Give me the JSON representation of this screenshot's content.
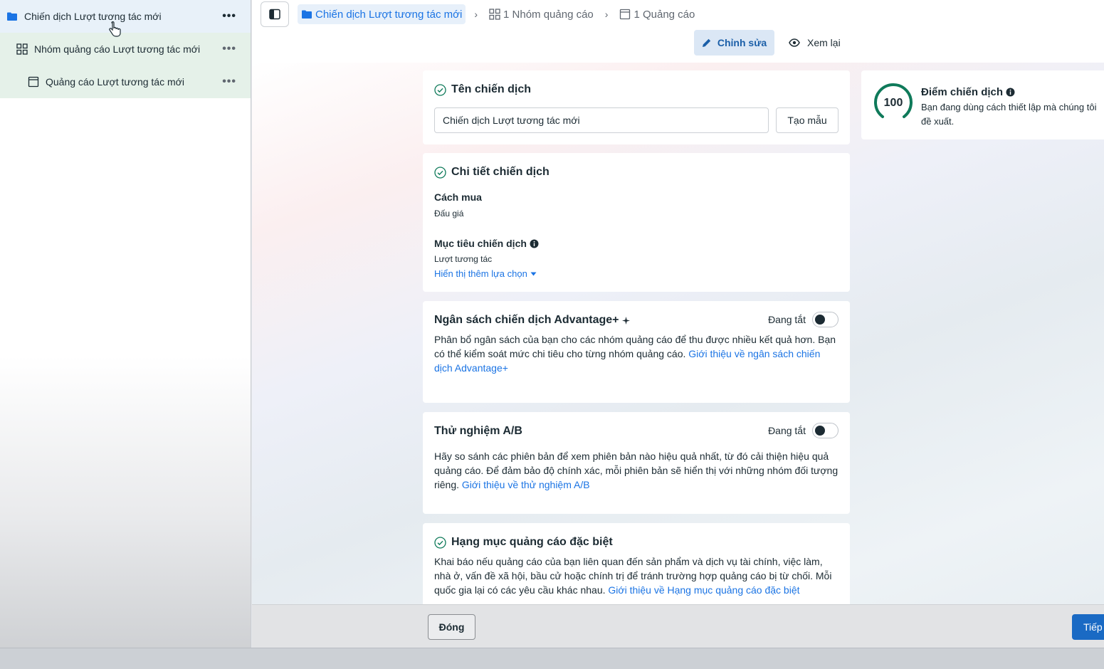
{
  "sidebar": {
    "campaign": "Chiến dịch Lượt tương tác mới",
    "adset": "Nhóm quảng cáo Lượt tương tác mới",
    "ad": "Quảng cáo Lượt tương tác mới",
    "more": "•••"
  },
  "breadcrumb": {
    "campaign": "Chiến dịch Lượt tương tác mới",
    "adsets": "1 Nhóm quảng cáo",
    "ads": "1 Quảng cáo"
  },
  "modes": {
    "edit": "Chỉnh sửa",
    "review": "Xem lại"
  },
  "campaign_name": {
    "title": "Tên chiến dịch",
    "value": "Chiến dịch Lượt tương tác mới",
    "template_button": "Tạo mẫu"
  },
  "details": {
    "title": "Chi tiết chiến dịch",
    "buying_label": "Cách mua",
    "buying_value": "Đấu giá",
    "objective_label": "Mục tiêu chiến dịch",
    "objective_value": "Lượt tương tác",
    "more_options": "Hiển thị thêm lựa chọn"
  },
  "budget": {
    "title": "Ngân sách chiến dịch Advantage+",
    "status": "Đang tắt",
    "desc": "Phân bổ ngân sách của bạn cho các nhóm quảng cáo để thu được nhiều kết quả hơn. Bạn có thể kiểm soát mức chi tiêu cho từng nhóm quảng cáo.",
    "link": "Giới thiệu về ngân sách chiến dịch Advantage+"
  },
  "ab_test": {
    "title": "Thử nghiệm A/B",
    "status": "Đang tắt",
    "desc": "Hãy so sánh các phiên bản để xem phiên bản nào hiệu quả nhất, từ đó cải thiện hiệu quả quảng cáo. Để đảm bảo độ chính xác, mỗi phiên bản sẽ hiển thị với những nhóm đối tượng riêng.",
    "link": "Giới thiệu về thử nghiệm A/B"
  },
  "special": {
    "title": "Hạng mục quảng cáo đặc biệt",
    "desc": "Khai báo nếu quảng cáo của bạn liên quan đến sản phẩm và dịch vụ tài chính, việc làm, nhà ở, vấn đề xã hội, bầu cử hoặc chính trị để tránh trường hợp quảng cáo bị từ chối. Mỗi quốc gia lại có các yêu cầu khác nhau.",
    "link": "Giới thiệu về Hạng mục quảng cáo đặc biệt"
  },
  "score": {
    "value": "100",
    "title": "Điểm chiến dịch",
    "desc": "Bạn đang dùng cách thiết lập mà chúng tôi đề xuất."
  },
  "footer": {
    "close": "Đóng",
    "next": "Tiếp"
  },
  "colors": {
    "accent": "#1b74e4",
    "score_ring": "#0f7a5a",
    "primary_button": "#1a6ac4"
  }
}
